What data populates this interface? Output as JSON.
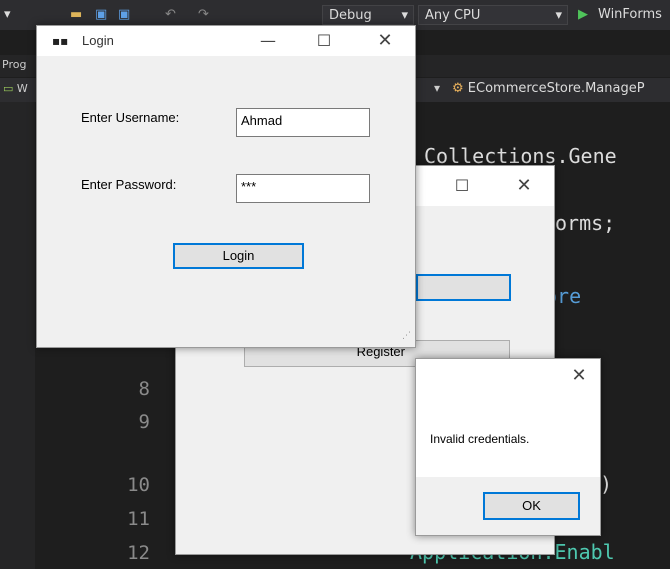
{
  "ide": {
    "toolbar": {
      "config": "Debug",
      "platform": "Any CPU",
      "run_target": "WinForms"
    },
    "panel_label": "Prog",
    "file_tab": "W",
    "nav_member": "ECommerceStore.ManageP",
    "line_numbers": [
      "8",
      "9",
      "10",
      "11",
      "12"
    ],
    "code": {
      "line_collections": "Collections.Gene",
      "line_forms": "orms;",
      "line_store": "ore",
      "line_paren": ")",
      "line_app": "Application.Enabl"
    }
  },
  "login": {
    "title": "Login",
    "username_label": "Enter Username:",
    "username_value": "Ahmad",
    "password_label": "Enter Password:",
    "password_value": "***",
    "login_button": "Login"
  },
  "main_form": {
    "register_button": "Register"
  },
  "message_box": {
    "text": "Invalid credentials.",
    "ok_button": "OK"
  },
  "colors": {
    "ide_background": "#1e1e1e",
    "focus_accent": "#0078d7",
    "dialog_face": "#f0f0f0"
  }
}
